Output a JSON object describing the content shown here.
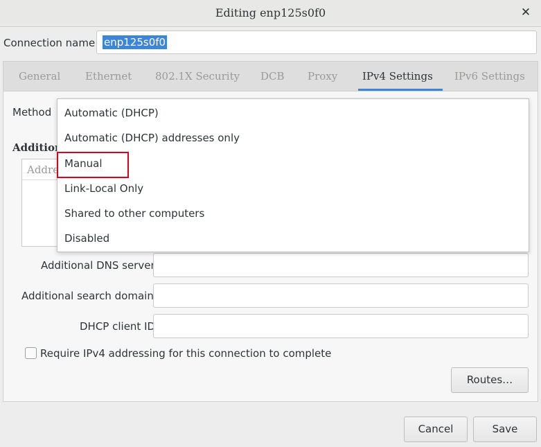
{
  "window": {
    "title": "Editing enp125s0f0",
    "close_glyph": "✕"
  },
  "connection": {
    "label": "Connection name",
    "value": "enp125s0f0"
  },
  "tabs": [
    {
      "label": "General",
      "active": false
    },
    {
      "label": "Ethernet",
      "active": false
    },
    {
      "label": "802.1X Security",
      "active": false
    },
    {
      "label": "DCB",
      "active": false
    },
    {
      "label": "Proxy",
      "active": false
    },
    {
      "label": "IPv4 Settings",
      "active": true
    },
    {
      "label": "IPv6 Settings",
      "active": false
    }
  ],
  "ipv4": {
    "method_label": "Method",
    "addresses_heading": "Addition",
    "address_column_partial": "Addre",
    "method_options": [
      "Automatic (DHCP)",
      "Automatic (DHCP) addresses only",
      "Manual",
      "Link-Local Only",
      "Shared to other computers",
      "Disabled"
    ],
    "highlighted_option": "Manual",
    "dns_label": "Additional DNS servers",
    "dns_value": "",
    "search_label": "Additional search domains",
    "search_value": "",
    "dhcp_id_label": "DHCP client ID",
    "dhcp_id_value": "",
    "require_label": "Require IPv4 addressing for this connection to complete",
    "require_checked": false,
    "routes_label": "Routes…"
  },
  "footer": {
    "cancel_label": "Cancel",
    "save_label": "Save"
  },
  "colors": {
    "accent": "#3d85d6",
    "highlight_box": "#e0001b"
  }
}
